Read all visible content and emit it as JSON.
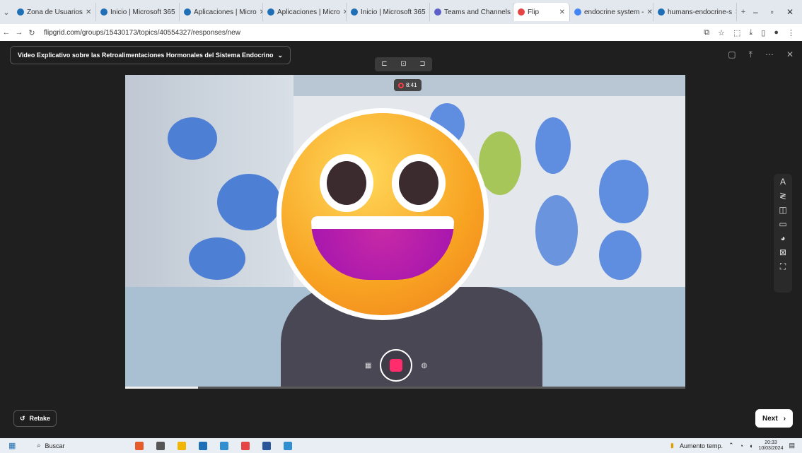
{
  "browser": {
    "tabs": [
      {
        "label": "Zona de Usuarios",
        "color": "#1e6fb5"
      },
      {
        "label": "Inicio | Microsoft 365",
        "color": "#1e6fb5"
      },
      {
        "label": "Aplicaciones | Micro",
        "color": "#1e6fb5"
      },
      {
        "label": "Aplicaciones | Micro",
        "color": "#1e6fb5"
      },
      {
        "label": "Inicio | Microsoft 365",
        "color": "#1e6fb5"
      },
      {
        "label": "Teams and Channels",
        "color": "#5b5fc7"
      },
      {
        "label": "Flip",
        "color": "#e64545"
      },
      {
        "label": "endocrine system - ",
        "color": "#4285f4"
      },
      {
        "label": "humans-endocrine-s",
        "color": "#1e6fb5"
      }
    ],
    "new_tab": "+",
    "url": "flipgrid.com/groups/15430173/topics/40554327/responses/new"
  },
  "app": {
    "topic_title": "Video Explicativo sobre las Retroalimentaciones Hormonales del Sistema Endocrino",
    "timer": "8:41",
    "progress_fraction": 0.13,
    "retake_label": "Retake",
    "next_label": "Next"
  },
  "taskbar": {
    "search_label": "Buscar",
    "weather": "Aumento temp.",
    "time": "20:33",
    "date": "10/03/2024"
  }
}
